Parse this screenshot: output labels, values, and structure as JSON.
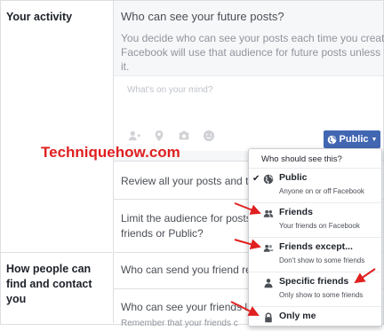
{
  "left": {
    "activity_title": "Your activity",
    "find_title": "How people can find and contact you"
  },
  "future_posts": {
    "question": "Who can see your future posts?",
    "description": "You decide who can see your posts each time you create a\nFacebook will use that audience for future posts unless yo\nit.",
    "composer_placeholder": "What's on your mind?",
    "audience_button": "Public",
    "composer_icons": [
      "add-person-icon",
      "location-pin-icon",
      "camera-icon",
      "smiley-icon"
    ]
  },
  "rows": {
    "review": "Review all your posts and thin",
    "limit": "Limit the audience for posts yo\nfriends or Public?",
    "friend_requests": "Who can send you friend requ",
    "friends_list": "Who can see your friends list",
    "friends_list_sub": "Remember that your friends c"
  },
  "watermark": "Techniquehow.com",
  "dropdown": {
    "header": "Who should see this?",
    "items": [
      {
        "label": "Public",
        "sub": "Anyone on or off Facebook",
        "icon": "globe-icon",
        "checked": true
      },
      {
        "label": "Friends",
        "sub": "Your friends on Facebook",
        "icon": "friends-icon"
      },
      {
        "label": "Friends except...",
        "sub": "Don't show to some friends",
        "icon": "friends-except-icon"
      },
      {
        "label": "Specific friends",
        "sub": "Only show to some friends",
        "icon": "person-icon"
      },
      {
        "label": "Only me",
        "sub": "",
        "icon": "lock-icon"
      }
    ]
  },
  "colors": {
    "accent": "#4267b2",
    "annotation": "#e02020"
  }
}
